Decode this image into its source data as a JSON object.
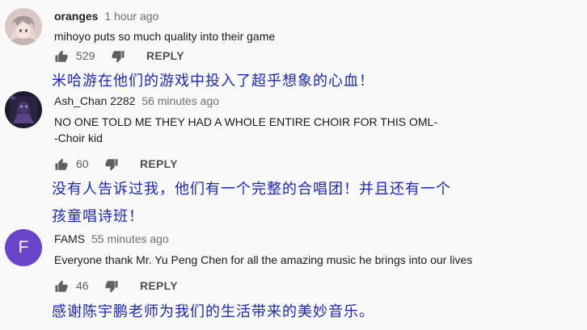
{
  "comments": [
    {
      "username": "oranges",
      "time": "1 hour ago",
      "lines": [
        "mihoyo puts so much quality into their game"
      ],
      "likes": "529",
      "reply_label": "REPLY",
      "avatar_icon": "anime-character-avatar",
      "subtitle_lines": [
        "米哈游在他们的游戏中投入了超乎想象的心血！"
      ]
    },
    {
      "username": "Ash_Chan 2282",
      "time": "56 minutes ago",
      "lines": [
        "NO ONE TOLD ME THEY HAD A WHOLE ENTIRE CHOIR FOR THIS OML-",
        "-Choir kid"
      ],
      "likes": "60",
      "reply_label": "REPLY",
      "avatar_icon": "dark-character-avatar",
      "subtitle_lines": [
        "没有人告诉过我，他们有一个完整的合唱团！并且还有一个",
        "孩童唱诗班！"
      ]
    },
    {
      "username": "FAMS",
      "time": "55 minutes ago",
      "lines": [
        "Everyone thank Mr. Yu Peng Chen for all the amazing music he brings into our lives"
      ],
      "likes": "46",
      "reply_label": "REPLY",
      "avatar_letter": "F",
      "avatar_color": "#6a45c9",
      "subtitle_lines": [
        "感谢陈宇鹏老师为我们的生活带来的美妙音乐。"
      ]
    }
  ],
  "colors": {
    "subtitle": "#1b27b8",
    "background": "#f9f9f9"
  }
}
